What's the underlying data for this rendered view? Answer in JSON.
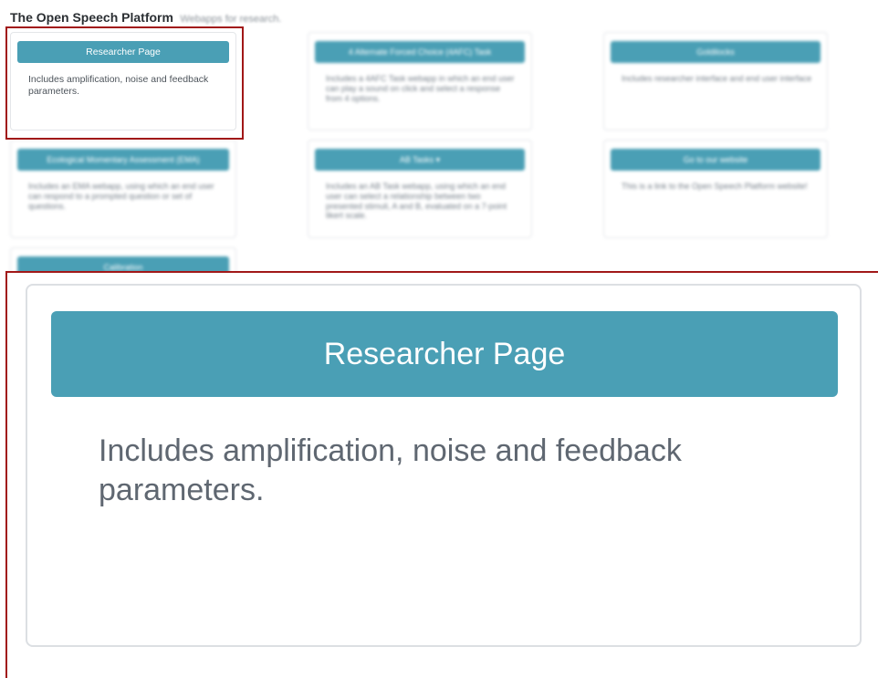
{
  "header": {
    "title": "The Open Speech Platform",
    "subtitle": "Webapps for research."
  },
  "cards": [
    {
      "button": "Researcher Page",
      "description": "Includes amplification, noise and feedback parameters."
    },
    {
      "button": "4 Alternate Forced Choice (4AFC) Task",
      "description": "Includes a 4AFC Task webapp in which an end user can play a sound on click and select a response from 4 options."
    },
    {
      "button": "Goldilocks",
      "description": "Includes researcher interface and end user interface"
    },
    {
      "button": "Ecological Momentary Assessment (EMA)",
      "description": "Includes an EMA webapp, using which an end user can respond to a prompted question or set of questions."
    },
    {
      "button": "AB Tasks ▾",
      "description": "Includes an AB Task webapp, using which an end user can select a relationship between two presented stimuli, A and B, evaluated on a 7-point likert scale."
    },
    {
      "button": "Go to our website",
      "description": "This is a link to the Open Speech Platform website!"
    },
    {
      "button": "Calibration",
      "description": ""
    }
  ],
  "zoom": {
    "button": "Researcher Page",
    "description": "Includes amplification, noise and feedback parameters."
  },
  "colors": {
    "button_bg": "#4a9fb5",
    "highlight_border": "#a11818"
  }
}
